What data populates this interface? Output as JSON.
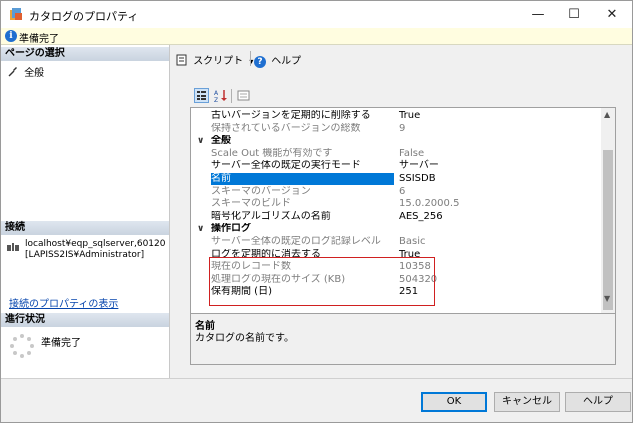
{
  "window": {
    "title": "カタログのプロパティ",
    "minimize": "—",
    "maximize": "☐",
    "close": "✕"
  },
  "status": {
    "text": "準備完了"
  },
  "left": {
    "page_select_header": "ページの選択",
    "pages": [
      {
        "label": "全般"
      }
    ],
    "connection_header": "接続",
    "connection_server": "localhost¥eqp_sqlserver,60120",
    "connection_user": "[LAPISS2IS¥Administrator]",
    "connection_link": "接続のプロパティの表示",
    "progress_header": "進行状況",
    "progress_text": "準備完了"
  },
  "toolbar": {
    "script_label": "スクリプト",
    "help_label": "ヘルプ"
  },
  "grid": {
    "rows": [
      {
        "name": "古いバージョンを定期的に削除する",
        "value": "True",
        "kind": "prop"
      },
      {
        "name": "保持されているバージョンの総数",
        "value": "9",
        "kind": "grey"
      },
      {
        "name": "全般",
        "value": "",
        "kind": "cat"
      },
      {
        "name": "Scale Out 機能が有効です",
        "value": "False",
        "kind": "grey"
      },
      {
        "name": "サーバー全体の既定の実行モード",
        "value": "サーバー",
        "kind": "prop"
      },
      {
        "name": "名前",
        "value": "SSISDB",
        "kind": "sel"
      },
      {
        "name": "スキーマのバージョン",
        "value": "6",
        "kind": "grey"
      },
      {
        "name": "スキーマのビルド",
        "value": "15.0.2000.5",
        "kind": "grey"
      },
      {
        "name": "暗号化アルゴリズムの名前",
        "value": "AES_256",
        "kind": "prop"
      },
      {
        "name": "操作ログ",
        "value": "",
        "kind": "cat"
      },
      {
        "name": "サーバー全体の既定のログ記録レベル",
        "value": "Basic",
        "kind": "grey"
      },
      {
        "name": "ログを定期的に消去する",
        "value": "True",
        "kind": "prop"
      },
      {
        "name": "現在のレコード数",
        "value": "10358",
        "kind": "grey"
      },
      {
        "name": "処理ログの現在のサイズ (KB)",
        "value": "504320",
        "kind": "grey"
      },
      {
        "name": "保有期間 (日)",
        "value": "251",
        "kind": "prop"
      }
    ]
  },
  "description": {
    "title": "名前",
    "text": "カタログの名前です。"
  },
  "buttons": {
    "ok": "OK",
    "cancel": "キャンセル",
    "help": "ヘルプ"
  }
}
